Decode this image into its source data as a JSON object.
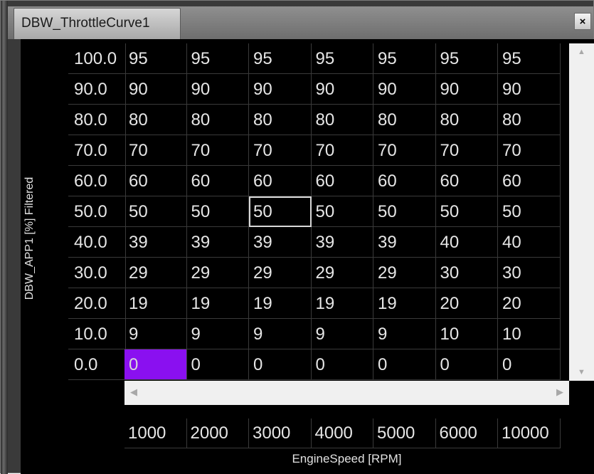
{
  "window": {
    "title": "DBW_ThrottleCurve1",
    "close_glyph": "×"
  },
  "axes": {
    "y_label": "DBW_APP1 [%] Filtered",
    "x_label": "EngineSpeed [RPM]",
    "columns": [
      "1000",
      "2000",
      "3000",
      "4000",
      "5000",
      "6000",
      "10000"
    ]
  },
  "rows": [
    {
      "label": "100.0",
      "values": [
        "95",
        "95",
        "95",
        "95",
        "95",
        "95",
        "95"
      ]
    },
    {
      "label": "90.0",
      "values": [
        "90",
        "90",
        "90",
        "90",
        "90",
        "90",
        "90"
      ]
    },
    {
      "label": "80.0",
      "values": [
        "80",
        "80",
        "80",
        "80",
        "80",
        "80",
        "80"
      ]
    },
    {
      "label": "70.0",
      "values": [
        "70",
        "70",
        "70",
        "70",
        "70",
        "70",
        "70"
      ]
    },
    {
      "label": "60.0",
      "values": [
        "60",
        "60",
        "60",
        "60",
        "60",
        "60",
        "60"
      ]
    },
    {
      "label": "50.0",
      "values": [
        "50",
        "50",
        "50",
        "50",
        "50",
        "50",
        "50"
      ]
    },
    {
      "label": "40.0",
      "values": [
        "39",
        "39",
        "39",
        "39",
        "39",
        "40",
        "40"
      ]
    },
    {
      "label": "30.0",
      "values": [
        "29",
        "29",
        "29",
        "29",
        "29",
        "30",
        "30"
      ]
    },
    {
      "label": "20.0",
      "values": [
        "19",
        "19",
        "19",
        "19",
        "19",
        "20",
        "20"
      ]
    },
    {
      "label": "10.0",
      "values": [
        "9",
        "9",
        "9",
        "9",
        "9",
        "10",
        "10"
      ]
    },
    {
      "label": "0.0",
      "values": [
        "0",
        "0",
        "0",
        "0",
        "0",
        "0",
        "0"
      ]
    }
  ],
  "selection": {
    "row": 10,
    "col": 0,
    "color": "#8a10f0"
  },
  "focus": {
    "row": 5,
    "col": 2
  },
  "icons": {
    "scroll_left": "◀",
    "scroll_right": "▶",
    "scroll_up": "▲",
    "scroll_down": "▼"
  }
}
